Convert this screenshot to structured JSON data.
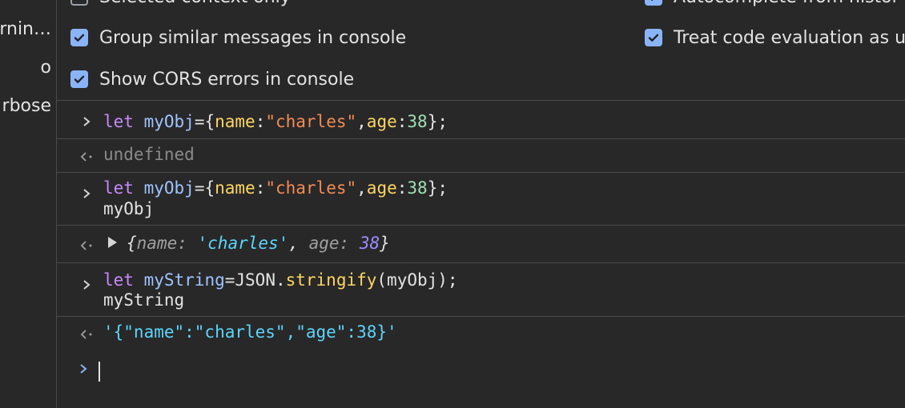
{
  "left_panel": {
    "items": [
      "arnin…",
      "o",
      "rbose"
    ]
  },
  "settings": {
    "items": [
      {
        "label": "Selected context only",
        "checked": false
      },
      {
        "label": "Autocomplete from histor",
        "checked": true
      },
      {
        "label": "Group similar messages in console",
        "checked": true
      },
      {
        "label": "Treat code evaluation as u",
        "checked": true
      },
      {
        "label": "Show CORS errors in console",
        "checked": true
      }
    ]
  },
  "console": {
    "entries": [
      {
        "type": "input",
        "lines": [
          "let myObj={name:\"charles\",age:38};"
        ]
      },
      {
        "type": "output",
        "text": "undefined"
      },
      {
        "type": "input",
        "lines": [
          "let myObj={name:\"charles\",age:38};",
          "myObj"
        ]
      },
      {
        "type": "output",
        "text": "{name: 'charles', age: 38}"
      },
      {
        "type": "input",
        "lines": [
          "let myString=JSON.stringify(myObj);",
          "myString"
        ]
      },
      {
        "type": "output",
        "text": "'{\"name\":\"charles\",\"age\":38}'"
      }
    ],
    "tokens": {
      "let": "let",
      "myObj": "myObj",
      "eq_brace": "={",
      "name": "name",
      "colon": ":",
      "charles": "\"charles\"",
      "comma": ",",
      "age": "age",
      "n38": "38",
      "close": "};",
      "myString": "myString",
      "eq_json": "=JSON.",
      "stringify": "stringify",
      "paren_obj": "(myObj);",
      "undefined": "undefined",
      "o_open": "{",
      "o_name": "name: ",
      "o_charles": "'charles'",
      "o_comma": ", ",
      "o_age": "age: ",
      "o_38": "38",
      "o_close": "}",
      "json_result": "'{\"name\":\"charles\",\"age\":38}'"
    }
  },
  "colors": {
    "background": "#282828",
    "checkbox": "#8ab4f8",
    "keyword": "#c58af9",
    "variable": "#9ec3ff",
    "property": "#fdd663",
    "string": "#f28b54",
    "number": "#9ee0b3"
  },
  "icons": {
    "prompt": "chevron-right-icon",
    "result": "return-arrow-icon",
    "expand": "triangle-right-icon",
    "checkbox": "checkmark-icon"
  }
}
